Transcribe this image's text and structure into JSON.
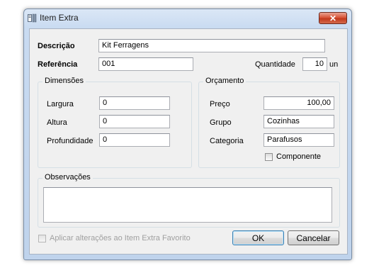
{
  "window": {
    "title": "Item Extra",
    "close_label": "✕"
  },
  "form": {
    "descricao_label": "Descrição",
    "descricao_value": "Kit Ferragens",
    "referencia_label": "Referência",
    "referencia_value": "001",
    "quantidade_label": "Quantidade",
    "quantidade_value": "10",
    "quantidade_unit": "un"
  },
  "dimensoes": {
    "title": "Dimensões",
    "largura_label": "Largura",
    "largura_value": "0",
    "altura_label": "Altura",
    "altura_value": "0",
    "profundidade_label": "Profundidade",
    "profundidade_value": "0"
  },
  "orcamento": {
    "title": "Orçamento",
    "preco_label": "Preço",
    "preco_value": "100,00",
    "grupo_label": "Grupo",
    "grupo_value": "Cozinhas",
    "categoria_label": "Categoria",
    "categoria_value": "Parafusos",
    "componente_label": "Componente"
  },
  "observacoes": {
    "title": "Observações",
    "value": ""
  },
  "footer": {
    "aplicar_label": "Aplicar alterações ao Item Extra Favorito",
    "ok_label": "OK",
    "cancel_label": "Cancelar"
  }
}
